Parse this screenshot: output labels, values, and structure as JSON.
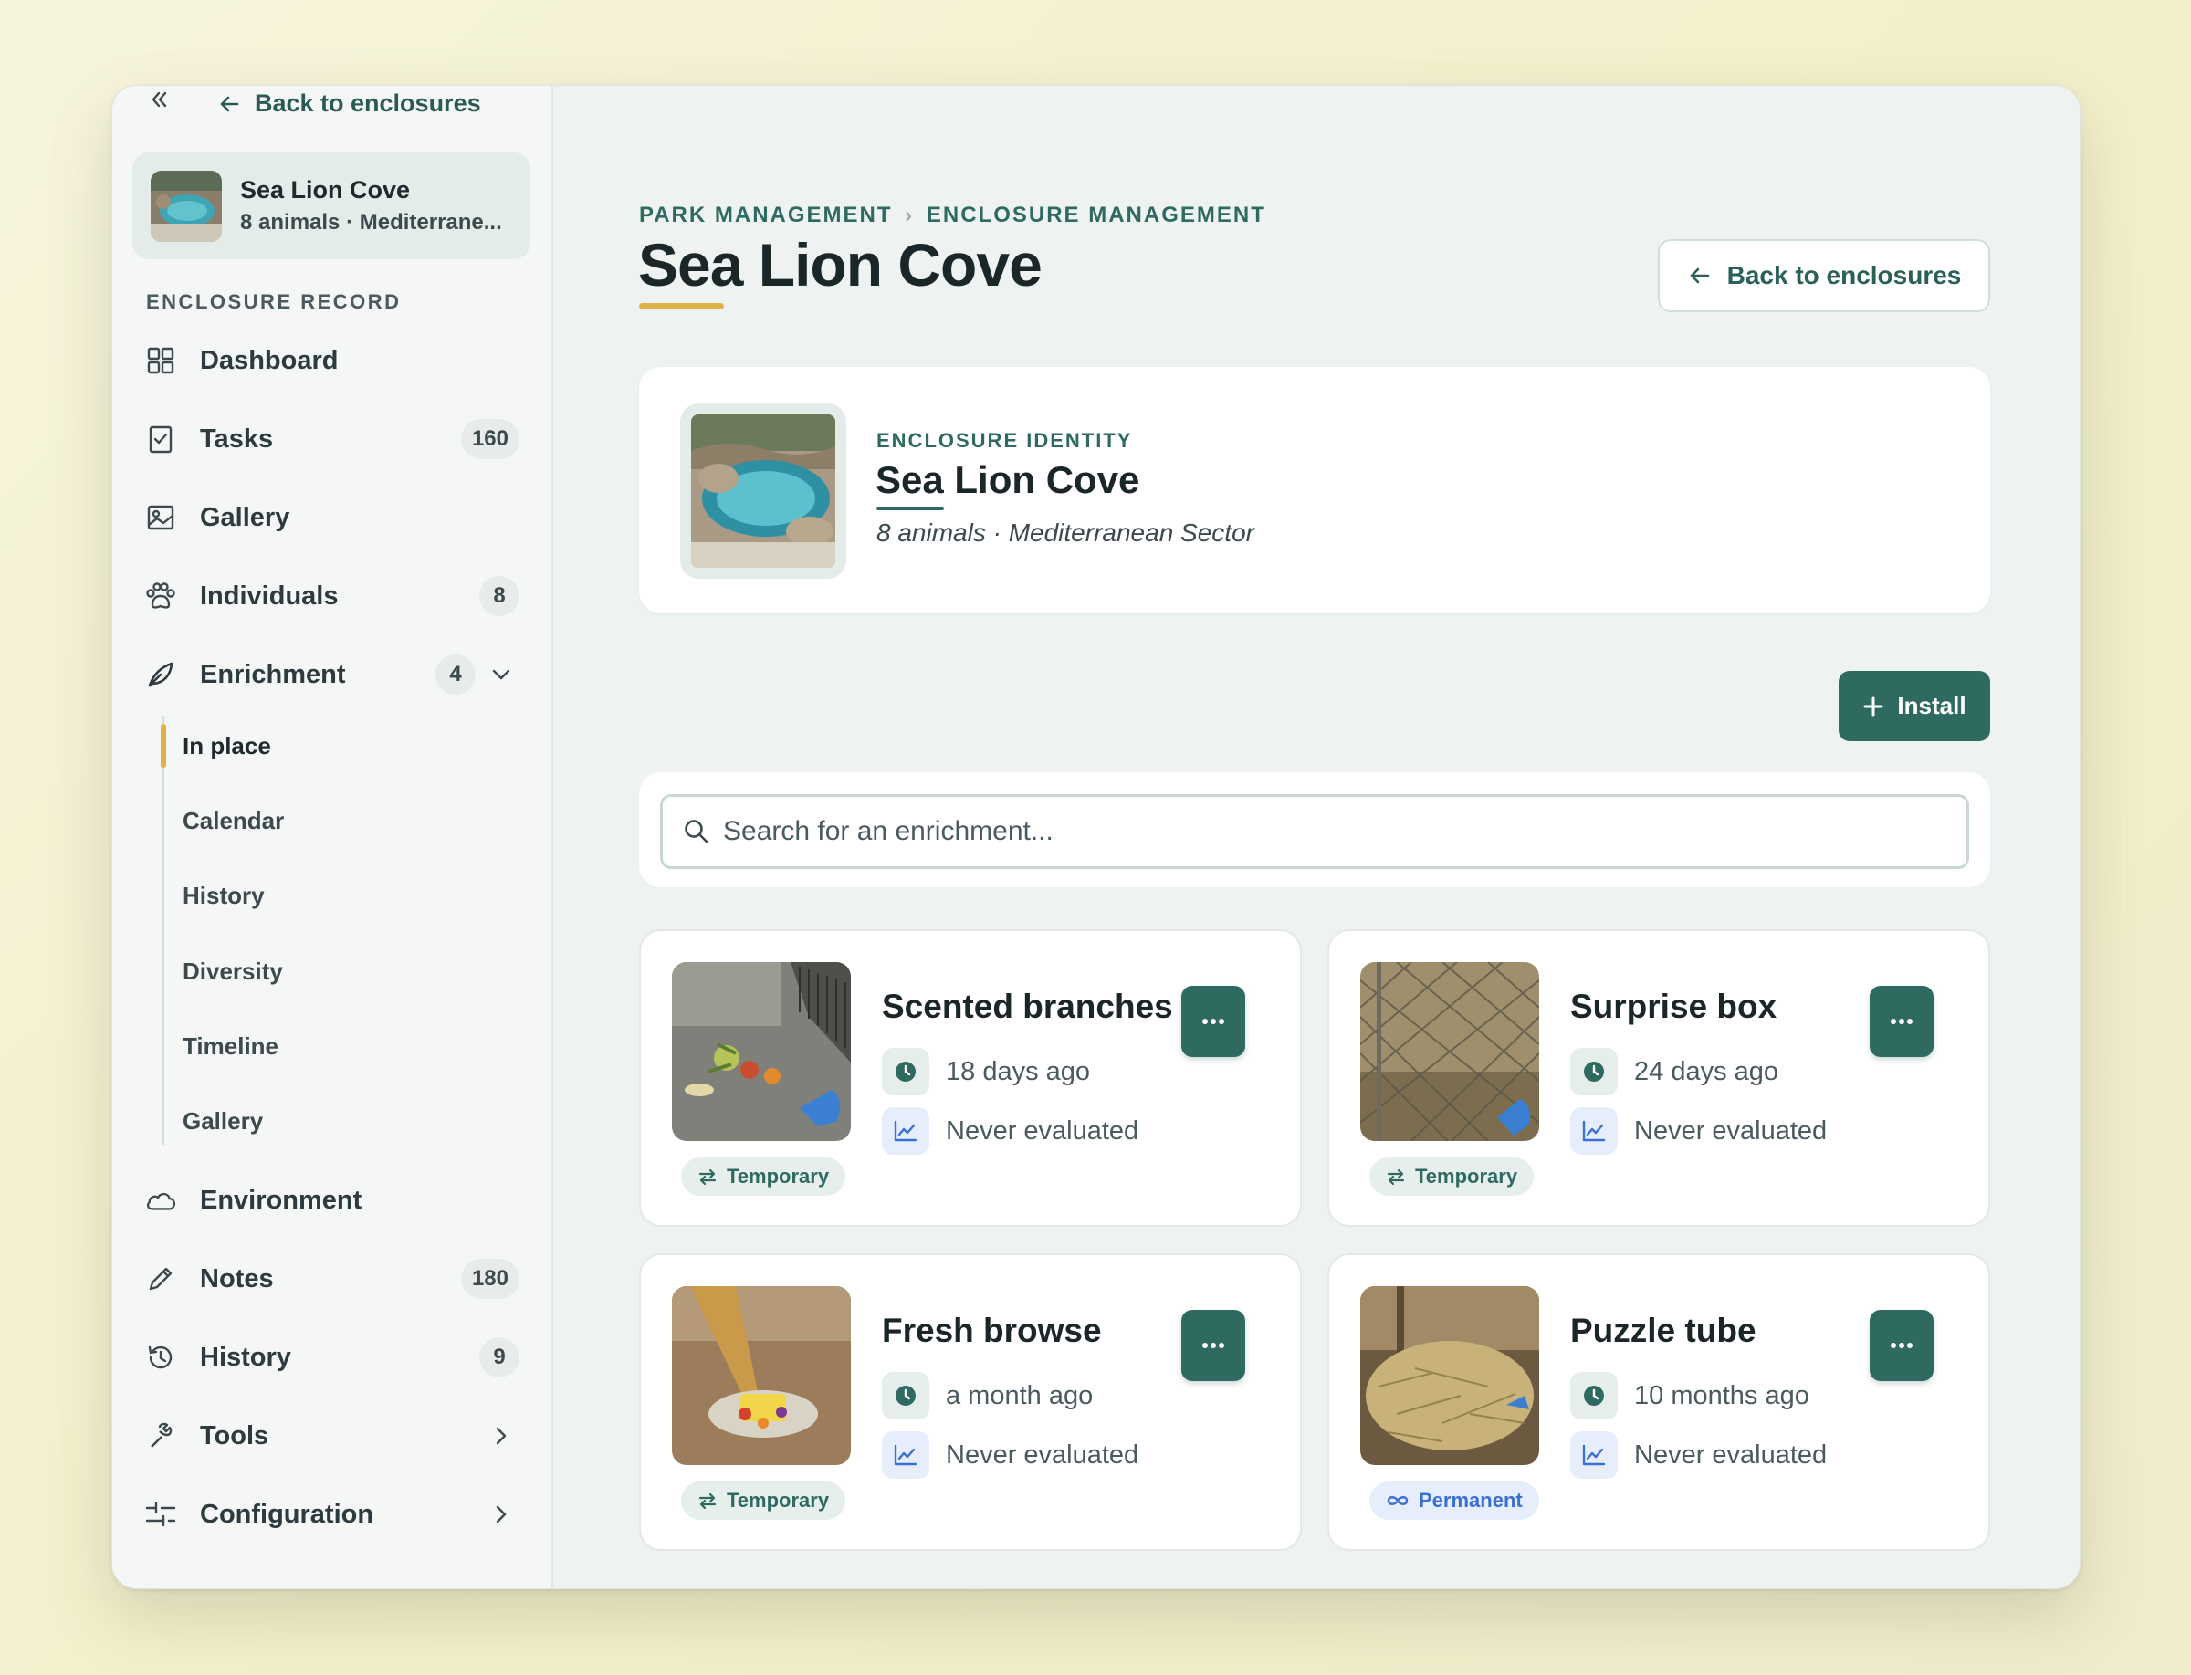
{
  "sidebar": {
    "back_label": "Back to enclosures",
    "enclosure": {
      "name": "Sea Lion Cove",
      "subtitle": "8 animals · Mediterrane..."
    },
    "section_label": "ENCLOSURE RECORD",
    "nav": {
      "dashboard": {
        "label": "Dashboard"
      },
      "tasks": {
        "label": "Tasks",
        "badge": "160"
      },
      "gallery": {
        "label": "Gallery"
      },
      "individuals": {
        "label": "Individuals",
        "badge": "8"
      },
      "enrichment": {
        "label": "Enrichment",
        "badge": "4"
      },
      "environment": {
        "label": "Environment"
      },
      "notes": {
        "label": "Notes",
        "badge": "180"
      },
      "history": {
        "label": "History",
        "badge": "9"
      },
      "tools": {
        "label": "Tools"
      },
      "configuration": {
        "label": "Configuration"
      }
    },
    "enrichment_sub": [
      "In place",
      "Calendar",
      "History",
      "Diversity",
      "Timeline",
      "Gallery"
    ]
  },
  "header": {
    "breadcrumb": [
      "PARK MANAGEMENT",
      "ENCLOSURE MANAGEMENT"
    ],
    "title": "Sea Lion Cove",
    "back_button": "Back to enclosures"
  },
  "identity": {
    "label": "ENCLOSURE IDENTITY",
    "name": "Sea Lion Cove",
    "subtitle": "8 animals · Mediterranean Sector"
  },
  "install_button": "Install",
  "search": {
    "placeholder": "Search for an enrichment..."
  },
  "enrichments": [
    {
      "title": "Scented branches",
      "installed": "18 days ago",
      "evaluation": "Never evaluated",
      "tag": "Temporary"
    },
    {
      "title": "Surprise box",
      "installed": "24 days ago",
      "evaluation": "Never evaluated",
      "tag": "Temporary"
    },
    {
      "title": "Fresh browse",
      "installed": "a month ago",
      "evaluation": "Never evaluated",
      "tag": "Temporary"
    },
    {
      "title": "Puzzle tube",
      "installed": "10 months ago",
      "evaluation": "Never evaluated",
      "tag": "Permanent"
    }
  ],
  "colors": {
    "accent": "#2e6a60",
    "highlight": "#e2b24a",
    "permanent": "#3b6fd1"
  },
  "icons": {
    "nav": [
      "dashboard-icon",
      "tasks-icon",
      "gallery-icon",
      "paw-icon",
      "leaf-icon",
      "cloud-icon",
      "pencil-icon",
      "history-icon",
      "tools-icon",
      "sliders-icon"
    ],
    "cards": [
      "clock-icon",
      "chart-icon",
      "more-icon",
      "swap-icon",
      "infinity-icon"
    ]
  }
}
